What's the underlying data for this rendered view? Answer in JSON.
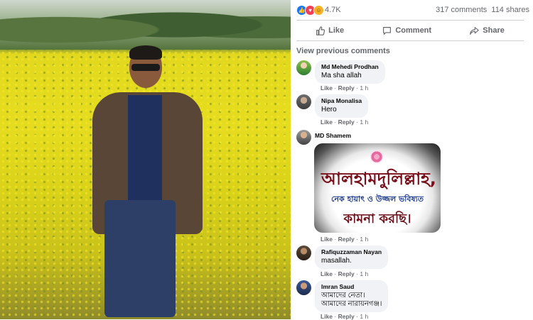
{
  "post": {
    "reactions": {
      "count": "4.7K",
      "icons": [
        "like-icon",
        "love-icon",
        "care-icon"
      ]
    },
    "comments_count": "317 comments",
    "shares_count": "114 shares",
    "actions": {
      "like": "Like",
      "comment": "Comment",
      "share": "Share"
    }
  },
  "comments_section": {
    "view_previous": "View previous comments",
    "meta": {
      "like": "Like",
      "reply": "Reply",
      "sep": "·"
    },
    "items": [
      {
        "name": "Md Mehedi Prodhan",
        "text": "Ma sha allah",
        "time": "1 h"
      },
      {
        "name": "Nipa Monalisa",
        "text": "Hero",
        "time": "1 h"
      },
      {
        "name": "MD Shamem",
        "text": "",
        "time": "1 h",
        "sticker": {
          "line1": "আলহামদুলিল্লাহ,",
          "line2": "নেক হায়াৎ ও উজ্জল ভবিষ্যত",
          "line3": "কামনা করছি।"
        }
      },
      {
        "name": "Rafiquzzaman Nayan",
        "text": "masallah.",
        "time": "1 h"
      },
      {
        "name": "Imran Saud",
        "text": "আমাদের নেতা।",
        "text2": "আমাদের নারায়নগঞ্জ।",
        "time": "1 h"
      }
    ]
  },
  "colors": {
    "accent": "#1877f2",
    "bubble": "#f0f2f5",
    "muted": "#65676b"
  }
}
